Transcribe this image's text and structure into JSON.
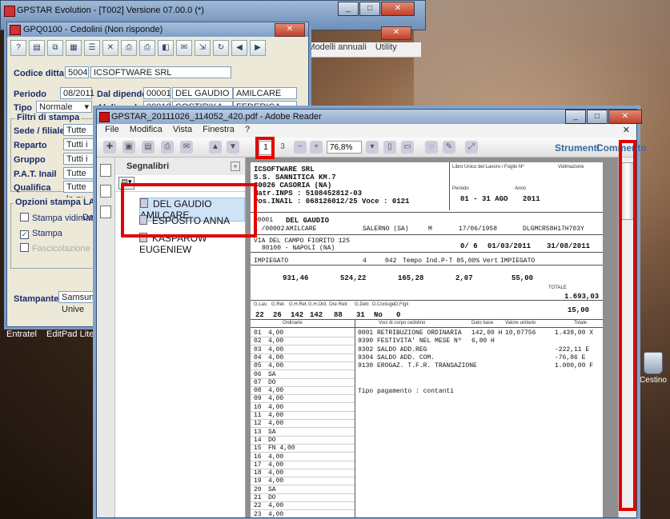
{
  "main_window": {
    "title": "GPSTAR Evolution - [T002]   Versione 07.00.0 (*)"
  },
  "submenu": {
    "items": [
      "A",
      "Modelli annuali",
      "Utility"
    ]
  },
  "dialog": {
    "title": "GPQ0100 - Cedolini (Non risponde)",
    "codice_ditta_label": "Codice ditta",
    "codice_ditta_code": "5004",
    "codice_ditta_name": "ICSOFTWARE SRL",
    "periodo_label": "Periodo",
    "periodo_value": "08/2011",
    "dal_label": "Dal dipendente",
    "dal_code": "00001",
    "dal_surname": "DEL GAUDIO",
    "dal_name": "AMILCARE",
    "tipo_label": "Tipo",
    "tipo_value": "Normale",
    "al_label": "Al dipendente",
    "al_code": "00010",
    "al_surname": "COSTIRIKA",
    "al_name": "FEDERICA",
    "filtri_label": "Filtri di stampa",
    "sede_label": "Sede / filiale",
    "sede_value": "Tutte le se",
    "reparto_label": "Reparto",
    "reparto_value": "Tutti i repa",
    "gruppo_label": "Gruppo",
    "gruppo_value": "Tutti i grup",
    "pat_label": "P.A.T. Inail",
    "pat_value": "Tutte le po",
    "qualifica_label": "Qualifica",
    "qualifica_value": "Tutte le qu",
    "opzioni_label": "Opzioni stampa LASER",
    "stampa_vidimati": "Stampa vidimati",
    "data_label": "Data",
    "stampa_label": "Stampa",
    "fascicolazione_label": "Fascicolazione",
    "stampante_label": "Stampante",
    "stampante_value": "Samsung Unive"
  },
  "taskbar": {
    "entratel": "Entratel",
    "editpad": "EditPad Lite"
  },
  "desktop": {
    "bin_label": "Cestino"
  },
  "adobe": {
    "title": "GPSTAR_20111026_114052_420.pdf - Adobe Reader",
    "menu": [
      "File",
      "Modifica",
      "Vista",
      "Finestra",
      "?"
    ],
    "page_current": "1",
    "page_total": "3",
    "zoom": "76,8%",
    "strumenti": "Strumenti",
    "commento": "Commento",
    "bookmarks_title": "Segnalibri",
    "bookmarks": [
      "DEL GAUDIO AMILCARE",
      "ESPOSITO ANNA",
      "KASPAROW EUGENIEW"
    ]
  },
  "payslip": {
    "company": "ICSOFTWARE SRL",
    "address1": "S.S. SANNITICA KM.7",
    "address2": "80026 CASORIA (NA)",
    "matr_inps": "Matr.INPS : 5108452812-03",
    "pos_inail": "Pos.INAIL : 068126012/25 Voce : 0121",
    "libro_label": "Libro Unico del Lavoro / Foglio Nº",
    "vidimazione_label": "Vidimazione",
    "periodo_label": "Periodo",
    "anno_label": "Anno",
    "periodo": "01 - 31 AGO",
    "anno": "2011",
    "cod": "00001",
    "surname": "DEL GAUDIO",
    "name": "AMILCARE",
    "matricola": "1 /00002",
    "luogo": "SALERNO (SA)",
    "sesso": "M",
    "data_nascita": "17/06/1958",
    "cf": "DLGMCR58H17H703Y",
    "indirizzo": "VIA DEL CAMPO FIORITO 125",
    "citta": "80100 - NAPOLI (NA)",
    "anzianita": "0/ 6",
    "inizio_rapporto": "01/03/2011",
    "fine_rapporto": "31/08/2011",
    "qualifica": "IMPIEGATO",
    "livello": "4",
    "ccontr": "042",
    "tipologia": "Tempo Ind.P-T 85,00%",
    "vert": "Vert",
    "mansione": "IMPIEGATO",
    "minimo": "931,46",
    "contingenza": "524,22",
    "scatti": "165,28",
    "terzo_elemento": "2,07",
    "superminimo": "55,00",
    "totale_label": "TOTALE",
    "totale": "1.693,03",
    "sesto_val": "15,00",
    "stat_labels": [
      "G.Lav.",
      "G.Ret.",
      "G.H.Ret.",
      "G.H.Ord.",
      "Ore Retr.",
      "G.Detr.",
      "D.Coniuge",
      "D.Figli"
    ],
    "stats": [
      "22",
      "26",
      "142",
      "142",
      "88",
      "31",
      "No",
      "0"
    ],
    "ore_label": "Ordinarie",
    "desc_label": "Voci di corpo cedolino",
    "dato_label": "Dato base",
    "valore_label": "Valore unitario",
    "tot_label": "Totale",
    "days": [
      {
        "d": "01",
        "h": "4,00"
      },
      {
        "d": "02",
        "h": "4,00"
      },
      {
        "d": "03",
        "h": "4,00"
      },
      {
        "d": "04",
        "h": "4,00"
      },
      {
        "d": "05",
        "h": "4,00"
      },
      {
        "d": "06",
        "h": "SA"
      },
      {
        "d": "07",
        "h": "DO"
      },
      {
        "d": "08",
        "h": "4,00"
      },
      {
        "d": "09",
        "h": "4,00"
      },
      {
        "d": "10",
        "h": "4,00"
      },
      {
        "d": "11",
        "h": "4,00"
      },
      {
        "d": "12",
        "h": "4,00"
      },
      {
        "d": "13",
        "h": "SA"
      },
      {
        "d": "14",
        "h": "DO"
      },
      {
        "d": "15",
        "h": "FN  4,00"
      },
      {
        "d": "16",
        "h": "4,00"
      },
      {
        "d": "17",
        "h": "4,00"
      },
      {
        "d": "18",
        "h": "4,00"
      },
      {
        "d": "19",
        "h": "4,00"
      },
      {
        "d": "20",
        "h": "SA"
      },
      {
        "d": "21",
        "h": "DO"
      },
      {
        "d": "22",
        "h": "4,00"
      },
      {
        "d": "23",
        "h": "4,00"
      },
      {
        "d": "24",
        "h": "4,00"
      }
    ],
    "voci": [
      {
        "desc": "0001 RETRIBUZIONE ORDINARIA",
        "base": "142,00 H",
        "unit": "10,07756",
        "tot": "1.439,00  X"
      },
      {
        "desc": "9390 FESTIVITA' NEL MESE    Nº",
        "base": "6,80 H",
        "unit": "",
        "tot": ""
      },
      {
        "desc": "9302 SALDO ADD.REG",
        "base": "",
        "unit": "",
        "tot": "-222,11  E"
      },
      {
        "desc": "9304 SALDO ADD. COM.",
        "base": "",
        "unit": "",
        "tot": "-76,86  E"
      },
      {
        "desc": "9130 EROGAZ. T.F.R. TRANSAZIONE",
        "base": "",
        "unit": "",
        "tot": "1.000,00  F"
      }
    ],
    "pagamento": "Tipo pagamento : contanti"
  }
}
